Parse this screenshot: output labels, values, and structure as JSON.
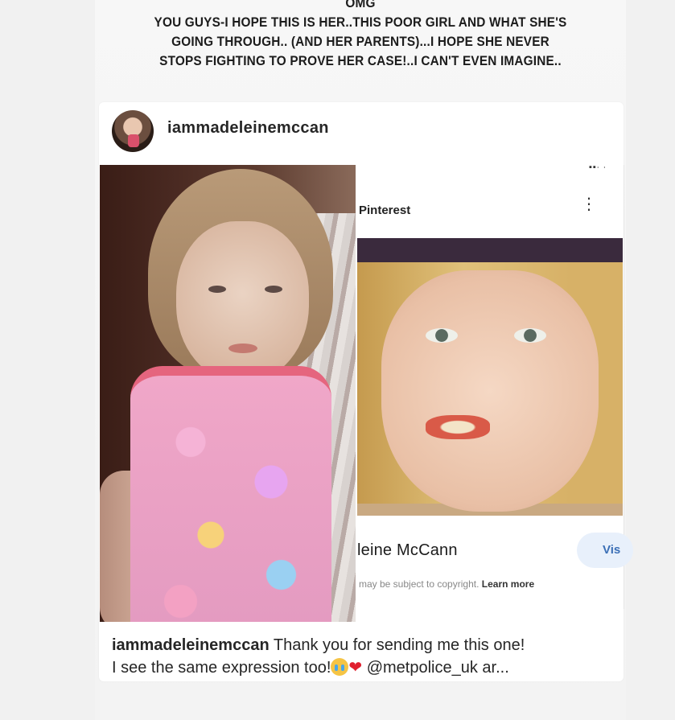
{
  "story": {
    "caption_lines": [
      "OMG",
      "YOU GUYS-I HOPE THIS IS HER..THIS POOR GIRL AND WHAT SHE'S",
      "GOING THROUGH.. (AND HER PARENTS)...I HOPE SHE NEVER",
      "STOPS FIGHTING TO PROVE HER CASE!..I CAN'T EVEN IMAGINE.."
    ]
  },
  "post": {
    "username": "iammadeleinemccan",
    "caption": {
      "username": "iammadeleinemccan",
      "text_1": "Thank you for sending me this one!",
      "text_2": "I see the same expression too!",
      "mention": "@metpolice_uk",
      "ellipsis": "ar...",
      "emojis": [
        "crying-face-icon",
        "red-heart-icon"
      ]
    }
  },
  "pinterest": {
    "status_bar": "▪▪∙ ∙",
    "app_title": "Pinterest",
    "name_text": "leine McCann",
    "visit_label": "Vis",
    "copyright_text": "may be subject to copyright.",
    "learn_more": "Learn more"
  },
  "colors": {
    "background": "#f1f1f1",
    "card": "#ffffff",
    "visit_button_bg": "#e8f0fb",
    "visit_button_text": "#3b6fb6"
  }
}
